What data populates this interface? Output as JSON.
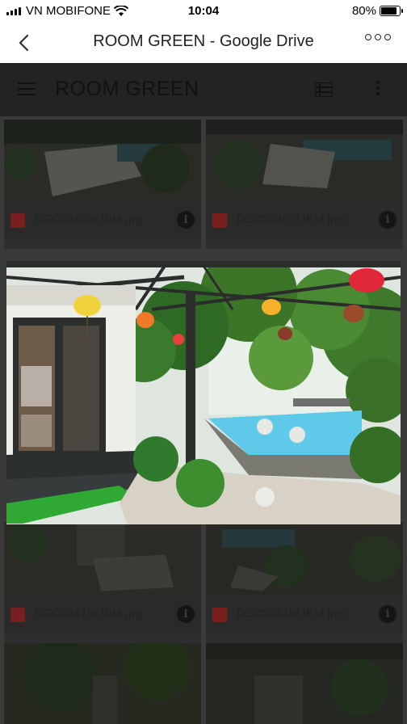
{
  "status_bar": {
    "carrier": "VN MOBIFONE",
    "time": "10:04",
    "battery": "80%",
    "battery_level": 0.8
  },
  "nav": {
    "title": "ROOM GREEN - Google Drive"
  },
  "drive": {
    "folder_title": "ROOM GREEN",
    "files": [
      {
        "name": "DSC02405LIEM.jpg"
      },
      {
        "name": "DSC02407LIEM.jpg"
      },
      {
        "name": "DSC02415LIEM.jpg"
      },
      {
        "name": "DSC02418LIEM.jpg"
      }
    ]
  },
  "colors": {
    "status_bg": "#ffffff",
    "overlay_bg": "#3a3a3a",
    "file_icon": "#7a1f1f"
  },
  "icons": {
    "back": "chevron-left-icon",
    "more": "more-horizontal-icon",
    "menu": "hamburger-menu-icon",
    "list": "list-view-icon",
    "kebab": "more-vertical-icon",
    "image_file": "image-file-icon",
    "info": "info-icon"
  }
}
